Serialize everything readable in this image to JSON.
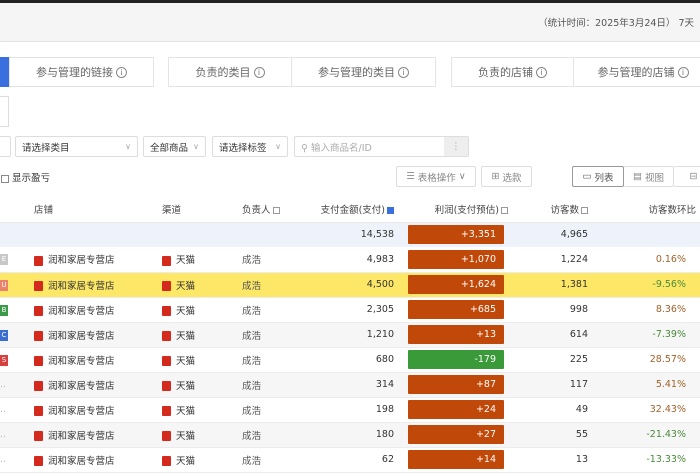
{
  "header": {
    "stat_time": "（统计时间：2025年3月24日）",
    "range": "7天"
  },
  "tabs": [
    {
      "label": "参与管理的链接"
    },
    {
      "label": "负责的类目"
    },
    {
      "label": "参与管理的类目"
    },
    {
      "label": "负责的店铺"
    },
    {
      "label": "参与管理的店铺"
    }
  ],
  "filters": {
    "category": "请选择类目",
    "goods": "全部商品",
    "tag": "请选择标签",
    "search_placeholder": "输入商品名/ID"
  },
  "toolbar": {
    "show_loss": "显示盈亏",
    "table_ops": "表格操作",
    "select": "选款",
    "list": "列表",
    "view": "视图"
  },
  "columns": [
    "店铺",
    "渠道",
    "负责人",
    "支付金额(支付)",
    "利润(支付预估)",
    "访客数",
    "访客数环比"
  ],
  "summary": {
    "amount": "14,538",
    "profit": "+3,351",
    "visitors": "4,965"
  },
  "colors": {
    "profit_pos": "#c0490a",
    "profit_neg": "#3a9a3a",
    "ratio_pos": "#a0622a",
    "ratio_neg": "#4a8a3a",
    "highlight": "#fde767"
  },
  "rows": [
    {
      "tag": "E",
      "tag_color": "#c8c8c8",
      "store": "润和家居专营店",
      "channel": "天猫",
      "owner": "成浩",
      "amount": "4,983",
      "profit": "+1,070",
      "visitors": "1,224",
      "ratio": "0.16%"
    },
    {
      "tag": "U",
      "tag_color": "#e8826a",
      "store": "润和家居专营店",
      "channel": "天猫",
      "owner": "成浩",
      "amount": "4,500",
      "profit": "+1,624",
      "visitors": "1,381",
      "ratio": "-9.56%",
      "highlight": true
    },
    {
      "tag": "B",
      "tag_color": "#3a9a4a",
      "store": "润和家居专营店",
      "channel": "天猫",
      "owner": "成浩",
      "amount": "2,305",
      "profit": "+685",
      "visitors": "998",
      "ratio": "8.36%"
    },
    {
      "tag": "C",
      "tag_color": "#3a6fd0",
      "store": "润和家居专营店",
      "channel": "天猫",
      "owner": "成浩",
      "amount": "1,210",
      "profit": "+13",
      "visitors": "614",
      "ratio": "-7.39%"
    },
    {
      "tag": "S",
      "tag_color": "#d84040",
      "store": "润和家居专营店",
      "channel": "天猫",
      "owner": "成浩",
      "amount": "680",
      "profit": "-179",
      "visitors": "225",
      "ratio": "28.57%"
    },
    {
      "tag": "",
      "tag_color": "",
      "store": "润和家居专营店",
      "channel": "天猫",
      "owner": "成浩",
      "amount": "314",
      "profit": "+87",
      "visitors": "117",
      "ratio": "5.41%"
    },
    {
      "tag": "",
      "tag_color": "",
      "store": "润和家居专营店",
      "channel": "天猫",
      "owner": "成浩",
      "amount": "198",
      "profit": "+24",
      "visitors": "49",
      "ratio": "32.43%"
    },
    {
      "tag": "",
      "tag_color": "",
      "store": "润和家居专营店",
      "channel": "天猫",
      "owner": "成浩",
      "amount": "180",
      "profit": "+27",
      "visitors": "55",
      "ratio": "-21.43%"
    },
    {
      "tag": "",
      "tag_color": "",
      "store": "润和家居专营店",
      "channel": "天猫",
      "owner": "成浩",
      "amount": "62",
      "profit": "+14",
      "visitors": "13",
      "ratio": "-13.33%"
    }
  ]
}
